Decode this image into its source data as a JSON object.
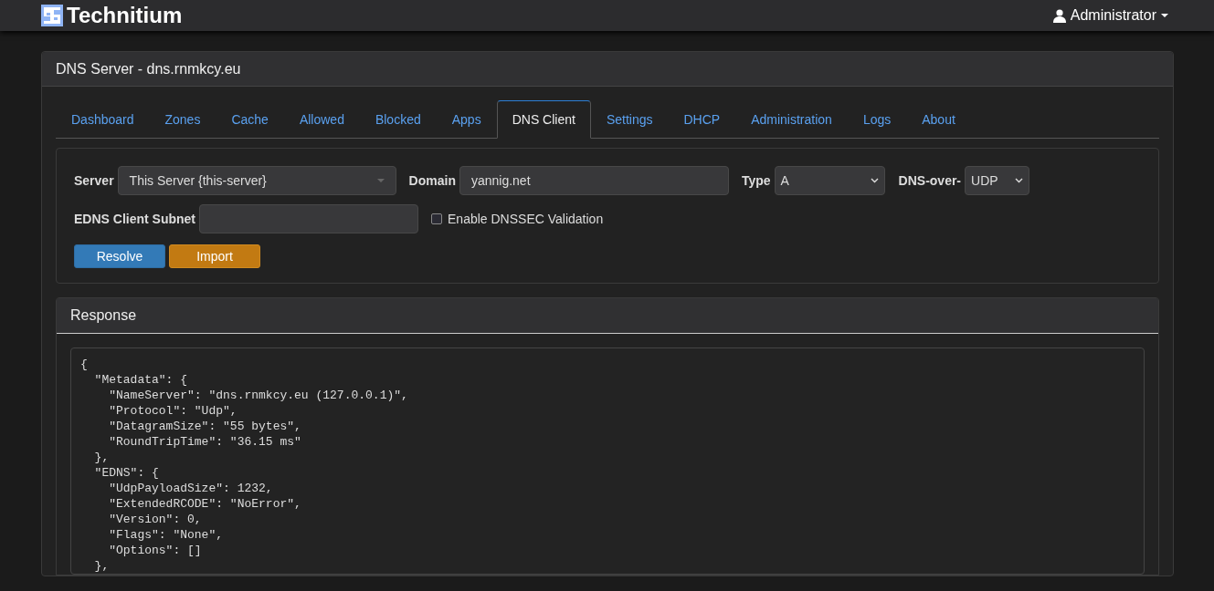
{
  "navbar": {
    "brand": "Technitium",
    "user": "Administrator"
  },
  "panel": {
    "title": "DNS Server - dns.rnmkcy.eu"
  },
  "tabs": [
    {
      "label": "Dashboard",
      "selected": false
    },
    {
      "label": "Zones",
      "selected": false
    },
    {
      "label": "Cache",
      "selected": false
    },
    {
      "label": "Allowed",
      "selected": false
    },
    {
      "label": "Blocked",
      "selected": false
    },
    {
      "label": "Apps",
      "selected": false
    },
    {
      "label": "DNS Client",
      "selected": true
    },
    {
      "label": "Settings",
      "selected": false
    },
    {
      "label": "DHCP",
      "selected": false
    },
    {
      "label": "Administration",
      "selected": false
    },
    {
      "label": "Logs",
      "selected": false
    },
    {
      "label": "About",
      "selected": false
    }
  ],
  "form": {
    "server": {
      "label": "Server",
      "value": "This Server {this-server}"
    },
    "domain": {
      "label": "Domain",
      "value": "yannig.net"
    },
    "type": {
      "label": "Type",
      "value": "A"
    },
    "protocol": {
      "label": "DNS-over-",
      "value": "UDP"
    },
    "edns": {
      "label": "EDNS Client Subnet"
    },
    "dnssec": {
      "label": "Enable DNSSEC Validation",
      "checked": false
    },
    "buttons": [
      {
        "label": "Resolve",
        "kind": "primary"
      },
      {
        "label": "Import",
        "kind": "warning"
      }
    ]
  },
  "response": {
    "title": "Response",
    "lines": [
      "{",
      "  \"Metadata\": {",
      "    \"NameServer\": \"dns.rnmkcy.eu (127.0.0.1)\",",
      "    \"Protocol\": \"Udp\",",
      "    \"DatagramSize\": \"55 bytes\",",
      "    \"RoundTripTime\": \"36.15 ms\"",
      "  },",
      "  \"EDNS\": {",
      "    \"UdpPayloadSize\": 1232,",
      "    \"ExtendedRCODE\": \"NoError\",",
      "    \"Version\": 0,",
      "    \"Flags\": \"None\",",
      "    \"Options\": []",
      "  },"
    ]
  }
}
